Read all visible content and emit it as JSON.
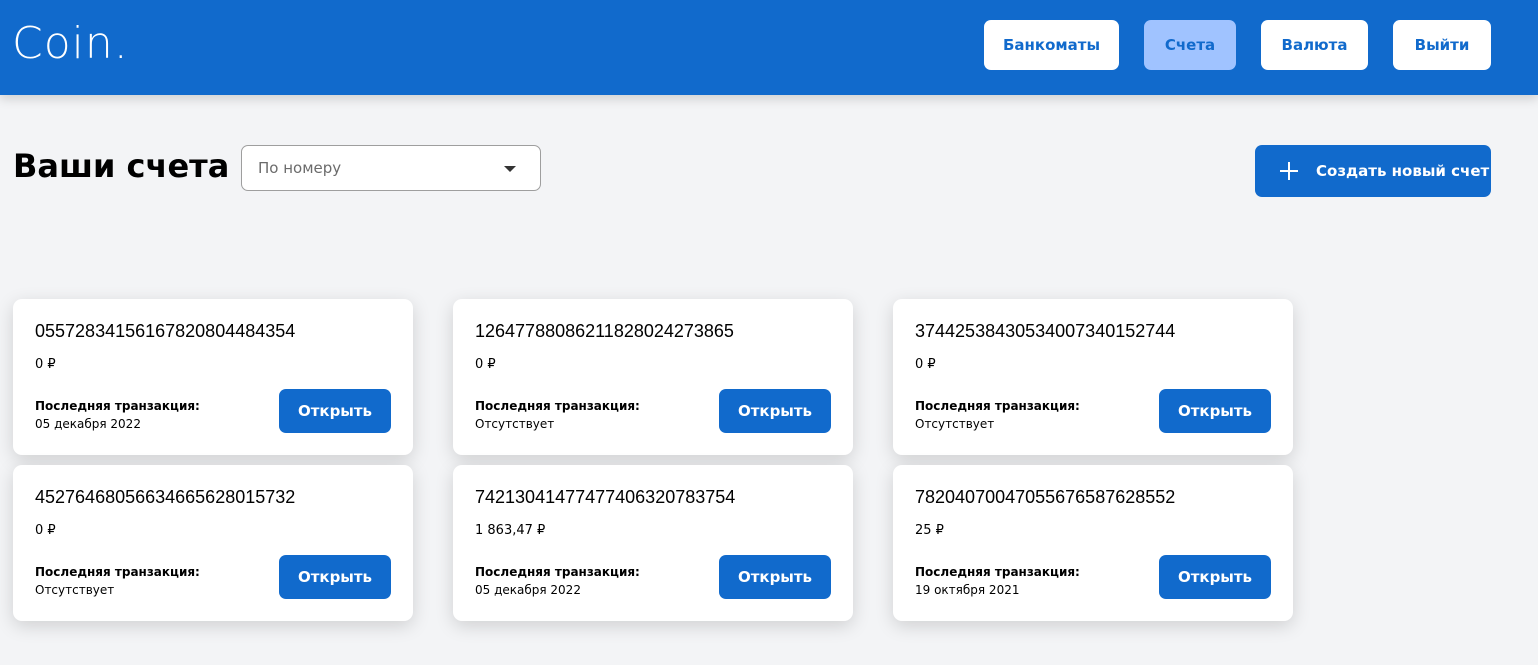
{
  "header": {
    "logo": "Coin.",
    "nav": [
      {
        "label": "Банкоматы",
        "active": false
      },
      {
        "label": "Счета",
        "active": true
      },
      {
        "label": "Валюта",
        "active": false
      },
      {
        "label": "Выйти",
        "active": false
      }
    ]
  },
  "toolbar": {
    "title": "Ваши счета",
    "sort_selected": "По номеру",
    "create_label": "Создать новый счет"
  },
  "accounts": [
    {
      "number": "05572834156167820804484354",
      "balance": "0 ₽",
      "last_tx_label": "Последняя транзакция:",
      "last_tx": "05 декабря 2022",
      "open_label": "Открыть"
    },
    {
      "number": "12647788086211828024273865",
      "balance": "0 ₽",
      "last_tx_label": "Последняя транзакция:",
      "last_tx": "Отсутствует",
      "open_label": "Открыть"
    },
    {
      "number": "37442538430534007340152744",
      "balance": "0 ₽",
      "last_tx_label": "Последняя транзакция:",
      "last_tx": "Отсутствует",
      "open_label": "Открыть"
    },
    {
      "number": "45276468056634665628015732",
      "balance": "0 ₽",
      "last_tx_label": "Последняя транзакция:",
      "last_tx": "Отсутствует",
      "open_label": "Открыть"
    },
    {
      "number": "74213041477477406320783754",
      "balance": "1 863,47 ₽",
      "last_tx_label": "Последняя транзакция:",
      "last_tx": "05 декабря 2022",
      "open_label": "Открыть"
    },
    {
      "number": "78204070047055676587628552",
      "balance": "25 ₽",
      "last_tx_label": "Последняя транзакция:",
      "last_tx": "19 октября 2021",
      "open_label": "Открыть"
    }
  ],
  "colors": {
    "brand": "#116acc",
    "active_nav": "#a0c3ff",
    "background": "#f3f4f6"
  }
}
